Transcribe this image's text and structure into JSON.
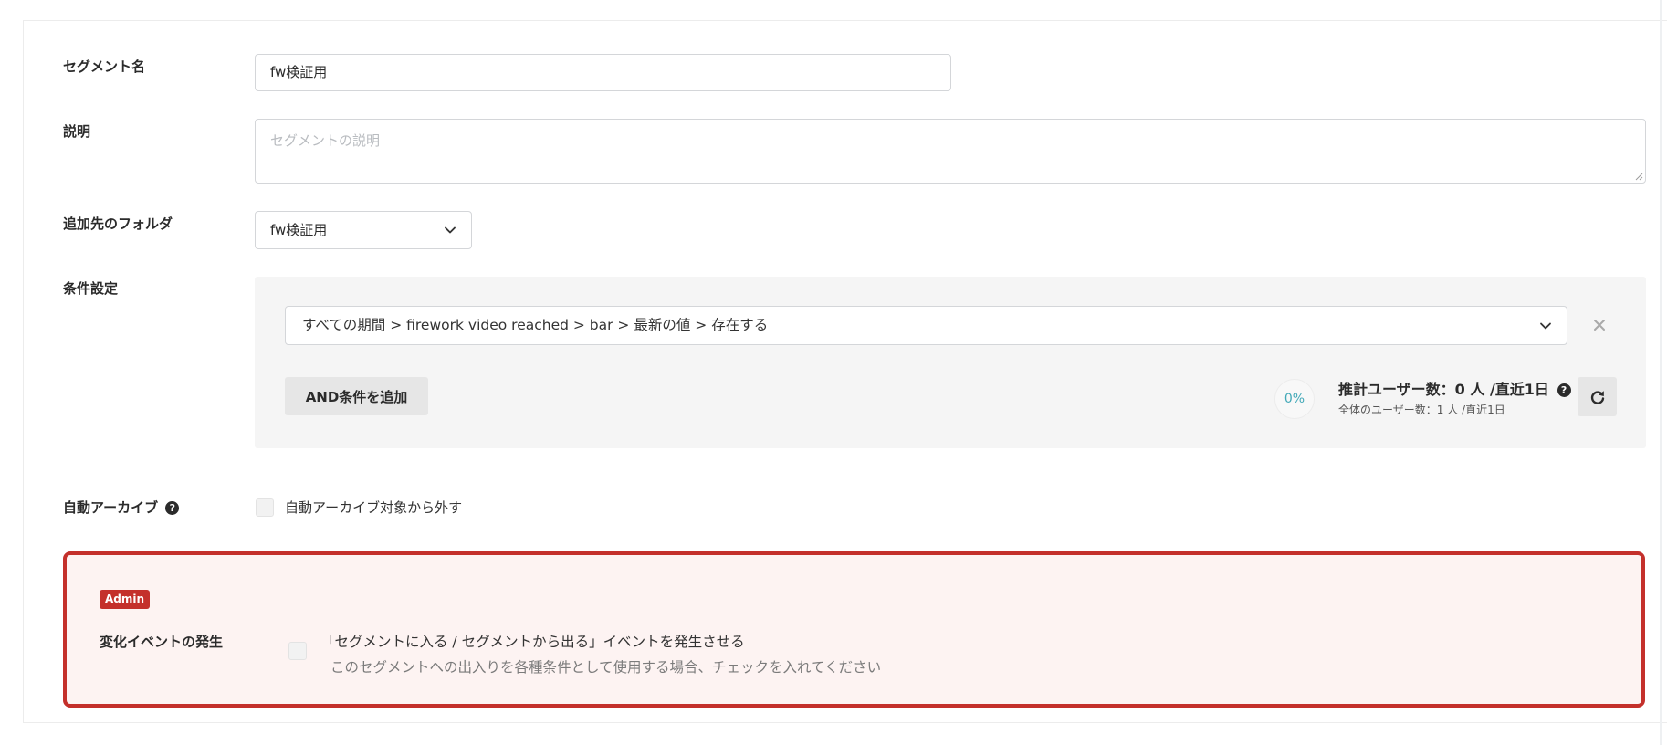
{
  "form": {
    "segment_name": {
      "label": "セグメント名",
      "value": "fw検証用"
    },
    "description": {
      "label": "説明",
      "placeholder": "セグメントの説明",
      "value": ""
    },
    "folder": {
      "label": "追加先のフォルダ",
      "selected": "fw検証用"
    },
    "conditions": {
      "label": "条件設定",
      "condition_text": "すべての期間 > firework video reached > bar > 最新の値 > 存在する",
      "add_and_label": "AND条件を追加",
      "percent": "0%",
      "estimate_main": "推計ユーザー数：0 人 /直近1日",
      "estimate_sub": "全体のユーザー数：1 人 /直近1日",
      "remove_glyph": "×"
    },
    "auto_archive": {
      "label": "自動アーカイブ",
      "checkbox_label": "自動アーカイブ対象から外す",
      "checked": false
    },
    "admin": {
      "badge": "Admin",
      "label": "変化イベントの発生",
      "checkbox_label": "「セグメントに入る / セグメントから出る」イベントを発生させる",
      "hint": "このセグメントへの出入りを各種条件として使用する場合、チェックを入れてください",
      "checked": false
    },
    "help_glyph": "?"
  },
  "colors": {
    "admin_border": "#c4302b",
    "admin_bg": "#fdf3f2",
    "percent_text": "#43a9b8",
    "condition_bg": "#f5f5f5",
    "button_bg": "#e6e6e6"
  },
  "icons": {
    "folder_dropdown": "chevron-down-icon",
    "condition_dropdown": "chevron-down-icon",
    "remove_condition": "close-icon",
    "estimate_help": "question-circle-icon",
    "refresh": "refresh-icon",
    "auto_archive_help": "question-circle-icon"
  }
}
